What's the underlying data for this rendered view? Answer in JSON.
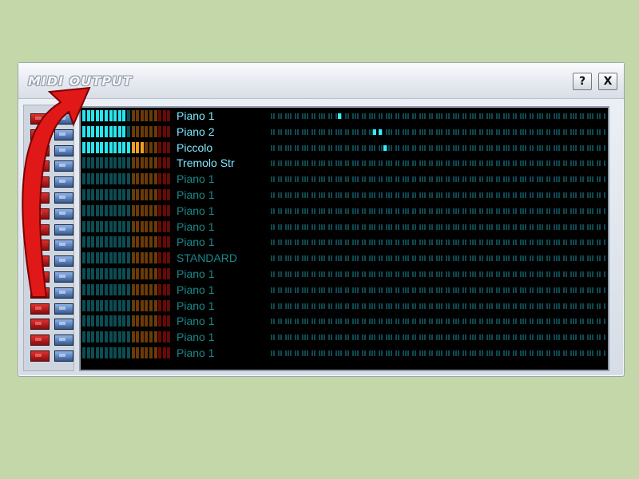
{
  "window": {
    "title": "MIDI OUTPUT",
    "help_label": "?",
    "close_label": "X"
  },
  "channels": [
    {
      "name": "Piano 1",
      "active": true,
      "level": 0.52,
      "lit_notes": [
        23
      ]
    },
    {
      "name": "Piano 2",
      "active": true,
      "level": 0.52,
      "lit_notes": [
        37,
        39
      ]
    },
    {
      "name": "Piccolo",
      "active": true,
      "level": 0.72,
      "lit_notes": [
        41
      ]
    },
    {
      "name": "Tremolo Str",
      "active": true,
      "level": 0.0,
      "lit_notes": []
    },
    {
      "name": "Piano 1",
      "active": false,
      "level": 0.0,
      "lit_notes": []
    },
    {
      "name": "Piano 1",
      "active": false,
      "level": 0.0,
      "lit_notes": []
    },
    {
      "name": "Piano 1",
      "active": false,
      "level": 0.0,
      "lit_notes": []
    },
    {
      "name": "Piano 1",
      "active": false,
      "level": 0.0,
      "lit_notes": []
    },
    {
      "name": "Piano 1",
      "active": false,
      "level": 0.0,
      "lit_notes": []
    },
    {
      "name": "STANDARD",
      "active": false,
      "level": 0.0,
      "lit_notes": []
    },
    {
      "name": "Piano 1",
      "active": false,
      "level": 0.0,
      "lit_notes": []
    },
    {
      "name": "Piano 1",
      "active": false,
      "level": 0.0,
      "lit_notes": []
    },
    {
      "name": "Piano 1",
      "active": false,
      "level": 0.0,
      "lit_notes": []
    },
    {
      "name": "Piano 1",
      "active": false,
      "level": 0.0,
      "lit_notes": []
    },
    {
      "name": "Piano 1",
      "active": false,
      "level": 0.0,
      "lit_notes": []
    },
    {
      "name": "Piano 1",
      "active": false,
      "level": 0.0,
      "lit_notes": []
    }
  ],
  "colors": {
    "background": "#c4d7a8",
    "meter_cyan_lit": "#28e6f0",
    "meter_cyan_dim": "#0b4d54",
    "meter_orange_lit": "#f0a020",
    "meter_orange_dim": "#6a3a08",
    "meter_red_dim": "#6a0808",
    "note_dim": "#0c4a52",
    "note_lit": "#33f0ff",
    "arrow": "#e01818"
  },
  "icons": {
    "mute": "red-led-icon",
    "solo": "blue-led-icon",
    "overlay": "red-curved-arrow-icon"
  }
}
